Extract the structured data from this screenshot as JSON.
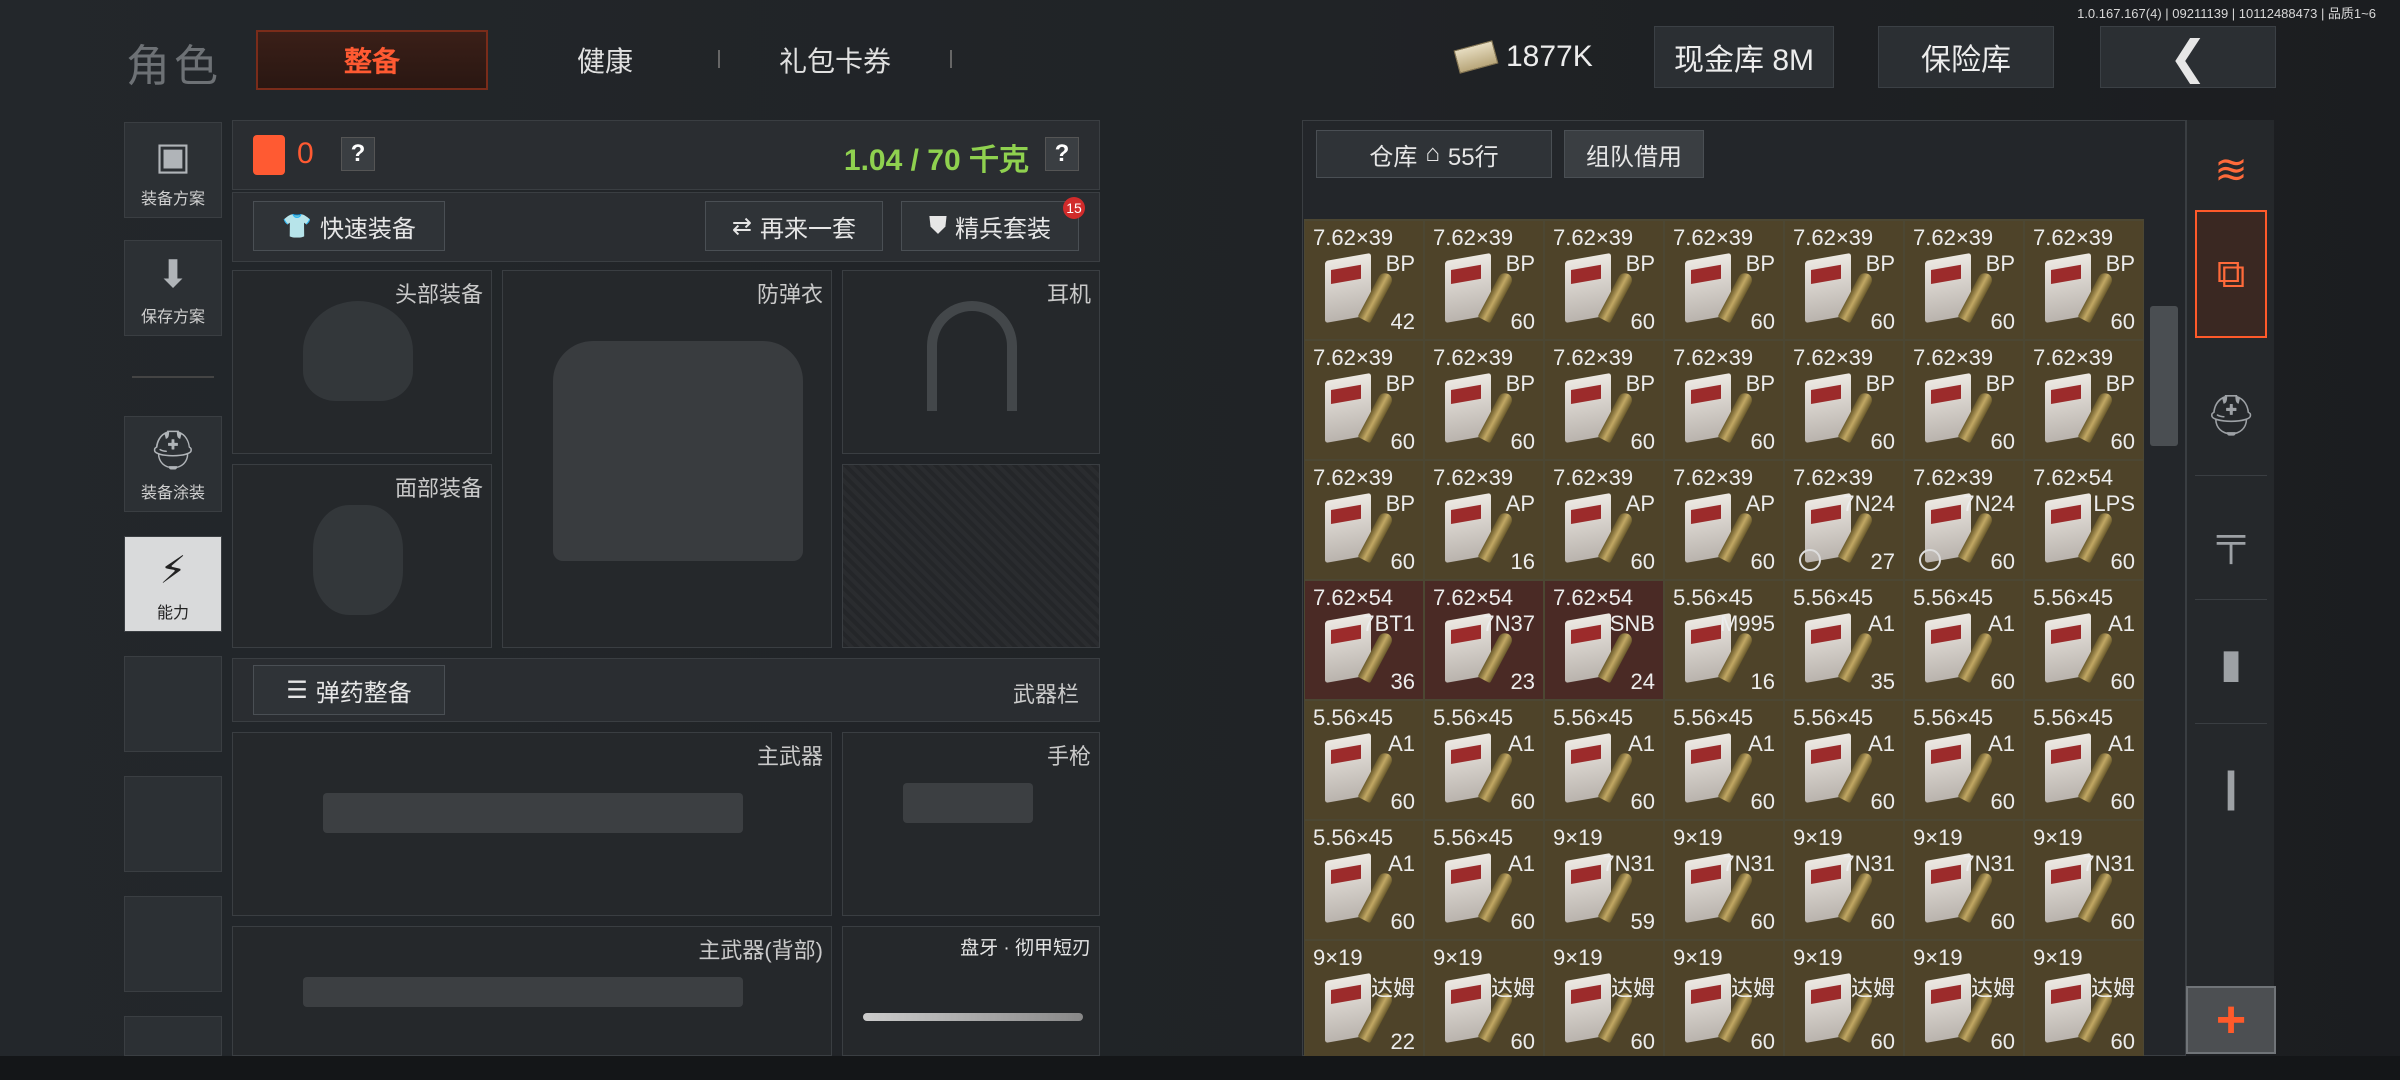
{
  "version": "1.0.167.167(4) | 09211139 | 10112488473 | 品质1~6",
  "header": {
    "title": "角色",
    "tabs": [
      "整备",
      "健康",
      "礼包卡券"
    ],
    "money": "1877K",
    "cash_vault": "现金库 8M",
    "safe": "保险库"
  },
  "sidebar": {
    "items": [
      "装备方案",
      "保存方案",
      "装备涂装",
      "能力"
    ]
  },
  "loadout": {
    "armor_count": "0",
    "weight": "1.04 / 70 千克",
    "help": "?",
    "quick_equip": "快速装备",
    "again": "再来一套",
    "elite": "精兵套装",
    "elite_badge": "15",
    "slots": {
      "helmet": "头部装备",
      "vest": "防弹衣",
      "headset": "耳机",
      "face": "面部装备"
    },
    "ammo_equip": "弹药整备",
    "weapon_bar": "武器栏",
    "weapon_slots": {
      "primary": "主武器",
      "pistol": "手枪",
      "primary_back": "主武器(背部)",
      "melee": "盘牙 · 彻甲短刃"
    }
  },
  "warehouse": {
    "tab": "仓库",
    "rows": "55行",
    "team_borrow": "组队借用"
  },
  "ammo_rows": [
    [
      [
        "7.62×39",
        "BP",
        "42"
      ],
      [
        "7.62×39",
        "BP",
        "60"
      ],
      [
        "7.62×39",
        "BP",
        "60"
      ],
      [
        "7.62×39",
        "BP",
        "60"
      ],
      [
        "7.62×39",
        "BP",
        "60"
      ],
      [
        "7.62×39",
        "BP",
        "60"
      ],
      [
        "7.62×39",
        "BP",
        "60"
      ]
    ],
    [
      [
        "7.62×39",
        "BP",
        "60"
      ],
      [
        "7.62×39",
        "BP",
        "60"
      ],
      [
        "7.62×39",
        "BP",
        "60"
      ],
      [
        "7.62×39",
        "BP",
        "60"
      ],
      [
        "7.62×39",
        "BP",
        "60"
      ],
      [
        "7.62×39",
        "BP",
        "60"
      ],
      [
        "7.62×39",
        "BP",
        "60"
      ]
    ],
    [
      [
        "7.62×39",
        "BP",
        "60"
      ],
      [
        "7.62×39",
        "AP",
        "16"
      ],
      [
        "7.62×39",
        "AP",
        "60"
      ],
      [
        "7.62×39",
        "AP",
        "60"
      ],
      [
        "7.62×39",
        "7N24",
        "27"
      ],
      [
        "7.62×39",
        "7N24",
        "60"
      ],
      [
        "7.62×54",
        "LPS",
        "60"
      ]
    ],
    [
      [
        "7.62×54",
        "7BT1",
        "36"
      ],
      [
        "7.62×54",
        "7N37",
        "23"
      ],
      [
        "7.62×54",
        "SNB",
        "24"
      ],
      [
        "5.56×45",
        "M995",
        "16"
      ],
      [
        "5.56×45",
        "A1",
        "35"
      ],
      [
        "5.56×45",
        "A1",
        "60"
      ],
      [
        "5.56×45",
        "A1",
        "60"
      ]
    ],
    [
      [
        "5.56×45",
        "A1",
        "60"
      ],
      [
        "5.56×45",
        "A1",
        "60"
      ],
      [
        "5.56×45",
        "A1",
        "60"
      ],
      [
        "5.56×45",
        "A1",
        "60"
      ],
      [
        "5.56×45",
        "A1",
        "60"
      ],
      [
        "5.56×45",
        "A1",
        "60"
      ],
      [
        "5.56×45",
        "A1",
        "60"
      ]
    ],
    [
      [
        "5.56×45",
        "A1",
        "60"
      ],
      [
        "5.56×45",
        "A1",
        "60"
      ],
      [
        "9×19",
        "7N31",
        "59"
      ],
      [
        "9×19",
        "7N31",
        "60"
      ],
      [
        "9×19",
        "7N31",
        "60"
      ],
      [
        "9×19",
        "7N31",
        "60"
      ],
      [
        "9×19",
        "7N31",
        "60"
      ]
    ],
    [
      [
        "9×19",
        "达姆",
        "22"
      ],
      [
        "9×19",
        "达姆",
        "60"
      ],
      [
        "9×19",
        "达姆",
        "60"
      ],
      [
        "9×19",
        "达姆",
        "60"
      ],
      [
        "9×19",
        "达姆",
        "60"
      ],
      [
        "9×19",
        "达姆",
        "60"
      ],
      [
        "9×19",
        "达姆",
        "60"
      ]
    ]
  ],
  "colors": {
    "accent": "#ff5a32",
    "weight_green": "#8fd14f",
    "cell_gold": "#4e4329",
    "cell_red": "#4a2a25"
  }
}
